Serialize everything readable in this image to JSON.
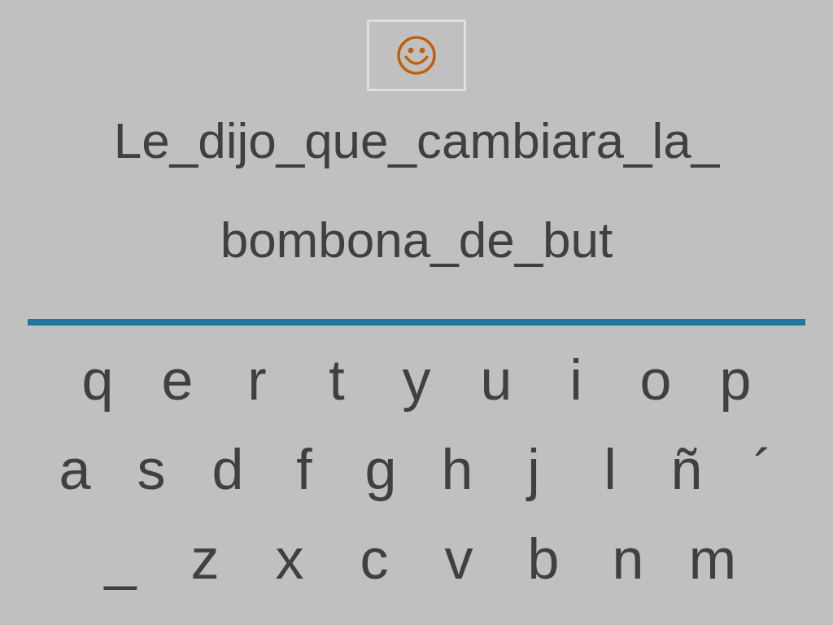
{
  "phrase": [
    "Le_dijo_que_cambiara_la_",
    "bombona_de_but"
  ],
  "keyboard": [
    [
      "q",
      "e",
      "r",
      "t",
      "y",
      "u",
      "i",
      "o",
      "p"
    ],
    [
      "a",
      "s",
      "d",
      "f",
      "g",
      "h",
      "j",
      "l",
      "ñ",
      "´"
    ],
    [
      "_",
      "z",
      "x",
      "c",
      "v",
      "b",
      "n",
      "m"
    ]
  ]
}
